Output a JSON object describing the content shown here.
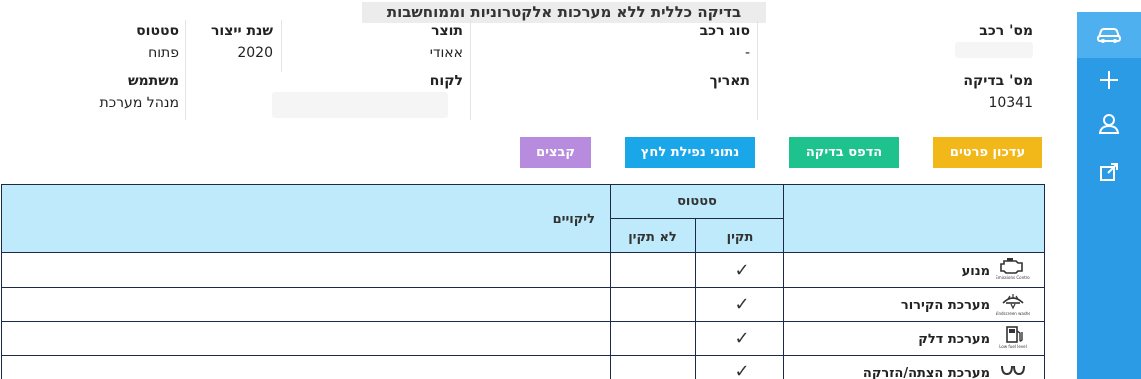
{
  "title": "בדיקה כללית ללא מערכות אלקטרוניות וממוחשבות",
  "info": {
    "vehicle_number_label": "מס' רכב",
    "vehicle_type_label": "סוג רכב",
    "vehicle_type_value": "-",
    "manufacturer_label": "תוצר",
    "manufacturer_value": "אאודי",
    "year_label": "שנת ייצור",
    "year_value": "2020",
    "status_label": "סטטוס",
    "status_value": "פתוח",
    "test_number_label": "מס' בדיקה",
    "test_number_value": "10341",
    "date_label": "תאריך",
    "customer_label": "לקוח",
    "user_label": "משתמש",
    "user_value": "מנהל מערכת"
  },
  "buttons": {
    "update": "עדכון פרטים",
    "print": "הדפס בדיקה",
    "pressure": "נתוני נפילת לחץ",
    "files": "קבצים"
  },
  "colors": {
    "sidebar": "#2b9be6",
    "update": "#f2b81a",
    "print": "#1ec28c",
    "pressure": "#1aa7ea",
    "files": "#b78cde",
    "table_header": "#bfeafb"
  },
  "table": {
    "status_header": "סטטוס",
    "ok_header": "תקין",
    "not_ok_header": "לא תקין",
    "defects_header": "ליקויים",
    "rows": [
      {
        "name": "מנוע",
        "icon": "engine-warning-icon",
        "ok": "✓"
      },
      {
        "name": "מערכת הקירור",
        "icon": "windscreen-washer-icon",
        "ok": "✓"
      },
      {
        "name": "מערכת דלק",
        "icon": "fuel-level-icon",
        "ok": "✓"
      },
      {
        "name": "מערכת הצתה/הזרקה",
        "icon": "glow-plug-icon",
        "ok": "✓"
      }
    ]
  }
}
